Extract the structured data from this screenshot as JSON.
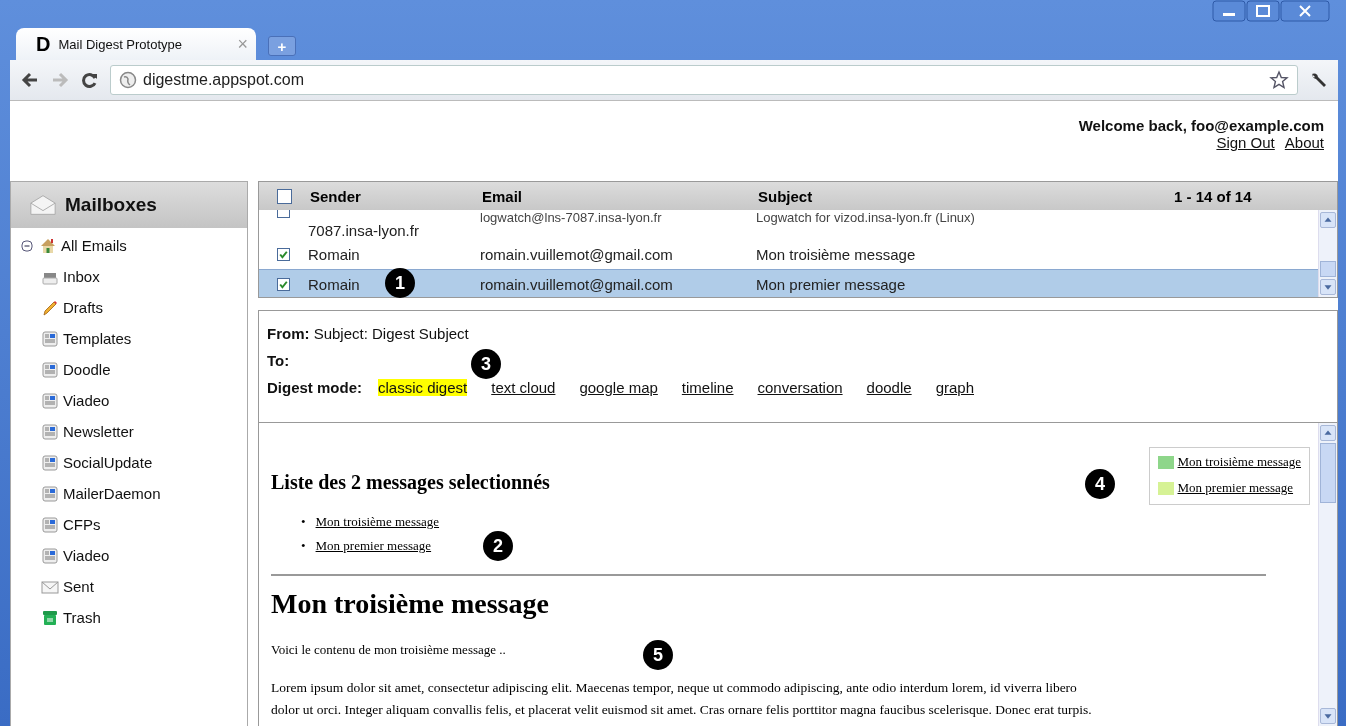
{
  "browser": {
    "favicon": "D",
    "tab_title": "Mail Digest Prototype",
    "tab_close": "×",
    "new_tab": "+",
    "url": "digestme.appspot.com"
  },
  "header": {
    "welcome": "Welcome back, foo@example.com",
    "links": [
      "Sign Out",
      "About"
    ]
  },
  "sidebar": {
    "title": "Mailboxes",
    "root": {
      "label": "All Emails",
      "expanded": true,
      "children": [
        {
          "label": "Inbox",
          "kind": "inbox"
        },
        {
          "label": "Drafts",
          "kind": "drafts"
        },
        {
          "label": "Templates",
          "kind": "folder"
        },
        {
          "label": "Doodle",
          "kind": "folder"
        },
        {
          "label": "Viadeo",
          "kind": "folder"
        },
        {
          "label": "Newsletter",
          "kind": "folder"
        },
        {
          "label": "SocialUpdate",
          "kind": "folder"
        },
        {
          "label": "MailerDaemon",
          "kind": "folder"
        },
        {
          "label": "CFPs",
          "kind": "folder"
        },
        {
          "label": "Viadeo",
          "kind": "folder"
        },
        {
          "label": "Sent",
          "kind": "sent"
        },
        {
          "label": "Trash",
          "kind": "trash"
        }
      ]
    }
  },
  "message_list": {
    "select_all": false,
    "columns": [
      "Sender",
      "Email",
      "Subject"
    ],
    "range": "1 - 14 of 14",
    "rows": [
      {
        "sender": "7087.insa-lyon.fr",
        "email": "logwatch@lns-7087.insa-lyon.fr",
        "subject": "Logwatch for vizod.insa-lyon.fr (Linux)",
        "checked": false,
        "selected": false
      },
      {
        "sender": "Romain",
        "email": "romain.vuillemot@gmail.com",
        "subject": "Mon troisième message",
        "checked": true,
        "selected": false
      },
      {
        "sender": "Romain",
        "email": "romain.vuillemot@gmail.com",
        "subject": "Mon premier message",
        "checked": true,
        "selected": true
      }
    ]
  },
  "preview": {
    "from_label": "From:",
    "from_value": "Subject: Digest Subject",
    "to_label": "To:",
    "mode_label": "Digest mode:",
    "modes": [
      {
        "label": "classic digest",
        "selected": true
      },
      {
        "label": "text cloud",
        "selected": false
      },
      {
        "label": "google map",
        "selected": false
      },
      {
        "label": "timeline",
        "selected": false
      },
      {
        "label": "conversation",
        "selected": false
      },
      {
        "label": "doodle",
        "selected": false
      },
      {
        "label": "graph",
        "selected": false
      }
    ]
  },
  "digest": {
    "heading": "Liste des 2 messages selectionnés",
    "items": [
      {
        "bullet": "•",
        "label": "Mon troisième message"
      },
      {
        "bullet": "•",
        "label": "Mon premier message"
      }
    ],
    "legend": [
      {
        "label": "Mon troisième message",
        "color": "#8ed68a"
      },
      {
        "label": "Mon premier message",
        "color": "#d6f295"
      }
    ],
    "message_title": "Mon troisième message",
    "intro": "Voici le contenu de mon troisième message ..",
    "body": [
      "Lorem ipsum dolor sit amet, consectetur adipiscing elit. Maecenas tempor, neque ut commodo adipiscing, ante odio interdum lorem, id viverra libero",
      "dolor ut orci. Integer aliquam convallis felis, et placerat velit euismod sit amet. Cras ornare felis porttitor magna faucibus scelerisque. Donec erat turpis."
    ]
  },
  "callouts": [
    "1",
    "2",
    "3",
    "4",
    "5"
  ]
}
